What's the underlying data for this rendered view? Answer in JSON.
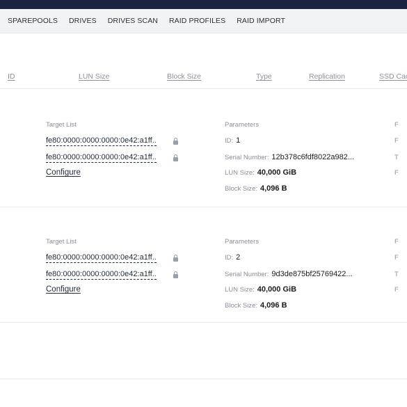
{
  "nav": {
    "tabs": [
      "SPAREPOOLS",
      "DRIVES",
      "DRIVES SCAN",
      "RAID PROFILES",
      "RAID IMPORT"
    ]
  },
  "table": {
    "headers": [
      "ID",
      "LUN Size",
      "Block Size",
      "Type",
      "Replication",
      "SSD Cac"
    ]
  },
  "rows": [
    {
      "target_list_label": "Target List",
      "targets": [
        "fe80:0000:0000:0000:0e42:a1ff..",
        "fe80:0000:0000:0000:0e42:a1ff.."
      ],
      "configure_label": "Configure",
      "parameters_label": "Parameters",
      "id_label": "ID:",
      "id": "1",
      "serial_label": "Serial Number:",
      "serial": "12b378c6fdf8022a982...",
      "lun_label": "LUN Size:",
      "lun_size": "40,000 GiB",
      "block_label": "Block Size:",
      "block_size": "4,096 B",
      "edge": [
        "F",
        "F",
        "T",
        "F"
      ]
    },
    {
      "target_list_label": "Target List",
      "targets": [
        "fe80:0000:0000:0000:0e42:a1ff..",
        "fe80:0000:0000:0000:0e42:a1ff.."
      ],
      "configure_label": "Configure",
      "parameters_label": "Parameters",
      "id_label": "ID:",
      "id": "2",
      "serial_label": "Serial Number:",
      "serial": "9d3de875bf25769422...",
      "lun_label": "LUN Size:",
      "lun_size": "40,000 GiB",
      "block_label": "Block Size:",
      "block_size": "4,096 B",
      "edge": [
        "F",
        "F",
        "T",
        "F"
      ]
    }
  ],
  "icons": {
    "lock": "lock-icon"
  }
}
